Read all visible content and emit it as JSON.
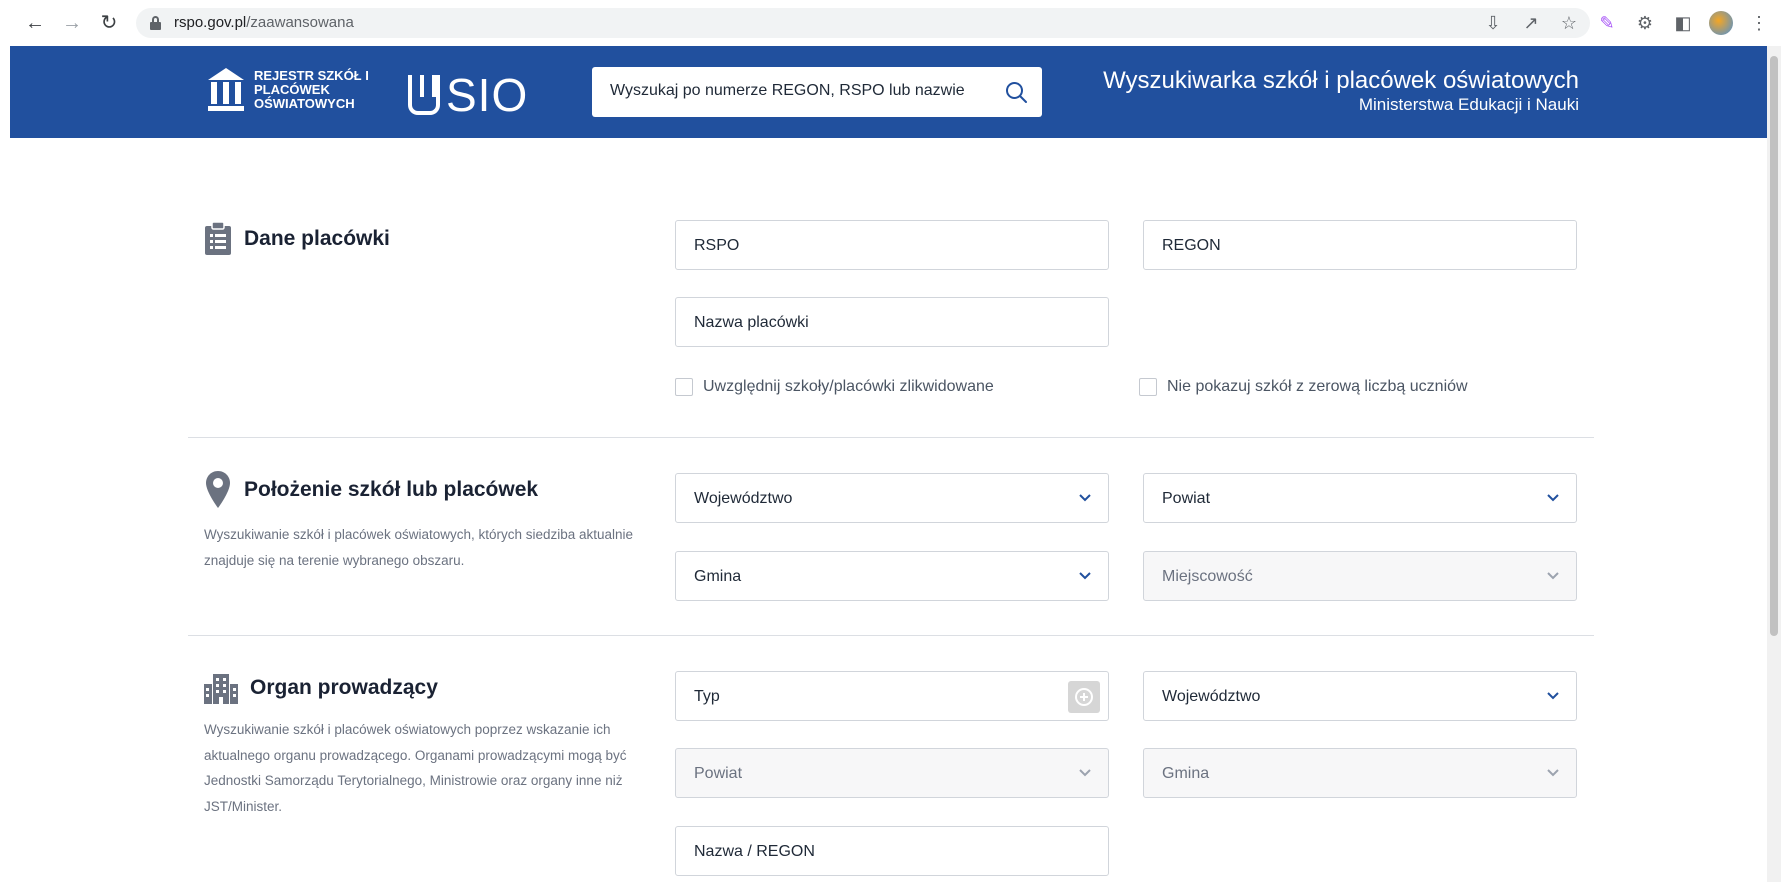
{
  "browser": {
    "url_host": "rspo.gov.pl",
    "url_path": "/zaawansowana"
  },
  "header": {
    "logo_rspo_text": "REJESTR SZKÓŁ I PLACÓWEK OŚWIATOWYCH",
    "logo_sio_text": "SIO",
    "search_placeholder": "Wyszukaj po numerze REGON, RSPO lub nazwie",
    "title_line1": "Wyszukiwarka szkół i placówek oświatowych",
    "title_line2": "Ministerstwa Edukacji i Nauki"
  },
  "dane": {
    "title": "Dane placówki",
    "rspo": "RSPO",
    "regon": "REGON",
    "nazwa": "Nazwa placówki",
    "chk_zlikwidowane": "Uwzględnij szkoły/placówki zlikwidowane",
    "chk_zero": "Nie pokazuj szkół z zerową liczbą uczniów"
  },
  "polozenie": {
    "title": "Położenie szkół lub placówek",
    "desc": "Wyszukiwanie szkół i placówek oświatowych, których siedziba aktualnie znajduje się na terenie wybranego obszaru.",
    "wojewodztwo": "Województwo",
    "powiat": "Powiat",
    "gmina": "Gmina",
    "miejscowosc": "Miejscowość"
  },
  "organ": {
    "title": "Organ prowadzący",
    "desc": "Wyszukiwanie szkół i placówek oświatowych poprzez wskazanie ich aktualnego organu prowadzącego. Organami prowadzącymi mogą być Jednostki Samorządu Terytorialnego, Ministrowie oraz organy inne niż JST/Minister.",
    "typ": "Typ",
    "wojewodztwo": "Województwo",
    "powiat": "Powiat",
    "gmina": "Gmina",
    "nazwa_regon": "Nazwa / REGON"
  },
  "colors": {
    "header_bg": "#21509e",
    "icon_gray": "#6b7280"
  },
  "icons": [
    "back-icon",
    "forward-icon",
    "reload-icon",
    "lock-icon",
    "search-icon",
    "chevron-down-icon",
    "clipboard-icon",
    "map-pin-icon",
    "buildings-icon",
    "plus-circle-icon"
  ]
}
